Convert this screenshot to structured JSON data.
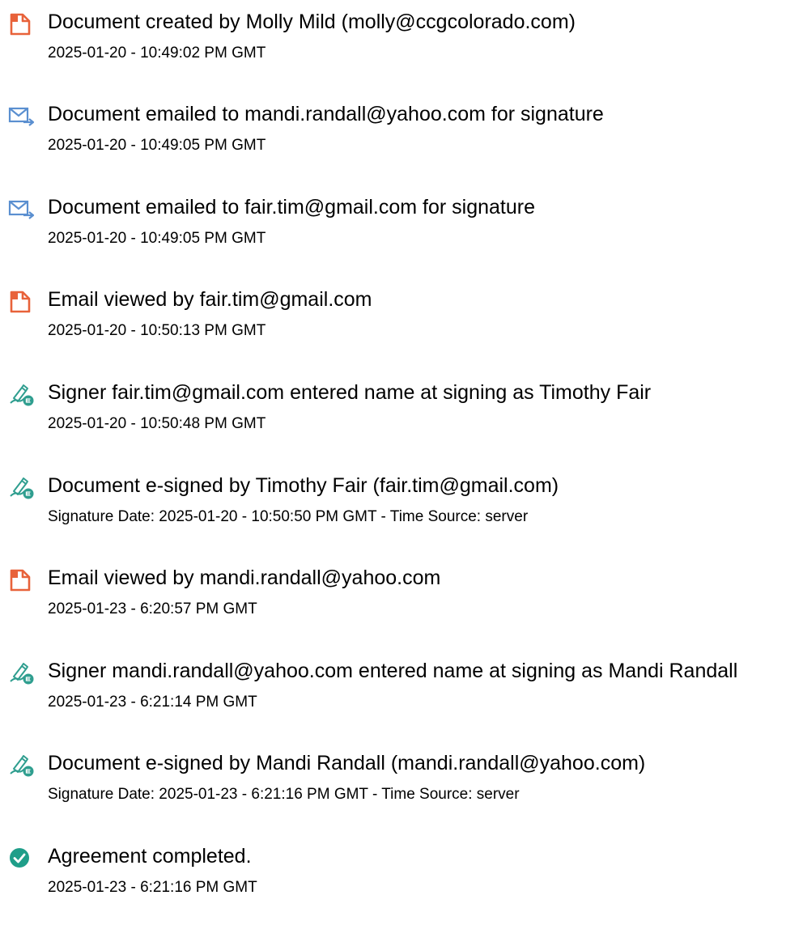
{
  "colors": {
    "doc_icon": "#e8623a",
    "email_icon": "#5a8fd0",
    "sign_icon": "#2f9e8f",
    "check_icon": "#1f9e89",
    "text": "#000000"
  },
  "events": [
    {
      "icon": "document-icon",
      "title": "Document created by Molly Mild (molly@ccgcolorado.com)",
      "meta": "2025-01-20 - 10:49:02 PM GMT"
    },
    {
      "icon": "email-sent-icon",
      "title": "Document emailed to mandi.randall@yahoo.com for signature",
      "meta": "2025-01-20 - 10:49:05 PM GMT"
    },
    {
      "icon": "email-sent-icon",
      "title": "Document emailed to fair.tim@gmail.com for signature",
      "meta": "2025-01-20 - 10:49:05 PM GMT"
    },
    {
      "icon": "document-icon",
      "title": "Email viewed by fair.tim@gmail.com",
      "meta": "2025-01-20 - 10:50:13 PM GMT"
    },
    {
      "icon": "signature-icon",
      "title": "Signer fair.tim@gmail.com entered name at signing as Timothy Fair",
      "meta": "2025-01-20 - 10:50:48 PM GMT"
    },
    {
      "icon": "signature-icon",
      "title": "Document e-signed by Timothy Fair (fair.tim@gmail.com)",
      "meta": "Signature Date: 2025-01-20 - 10:50:50 PM GMT - Time Source: server"
    },
    {
      "icon": "document-icon",
      "title": "Email viewed by mandi.randall@yahoo.com",
      "meta": "2025-01-23 - 6:20:57 PM GMT"
    },
    {
      "icon": "signature-icon",
      "title": "Signer mandi.randall@yahoo.com entered name at signing as Mandi Randall",
      "meta": "2025-01-23 - 6:21:14 PM GMT"
    },
    {
      "icon": "signature-icon",
      "title": "Document e-signed by Mandi Randall (mandi.randall@yahoo.com)",
      "meta": "Signature Date: 2025-01-23 - 6:21:16 PM GMT - Time Source: server"
    },
    {
      "icon": "check-circle-icon",
      "title": "Agreement completed.",
      "meta": "2025-01-23 - 6:21:16 PM GMT"
    }
  ]
}
